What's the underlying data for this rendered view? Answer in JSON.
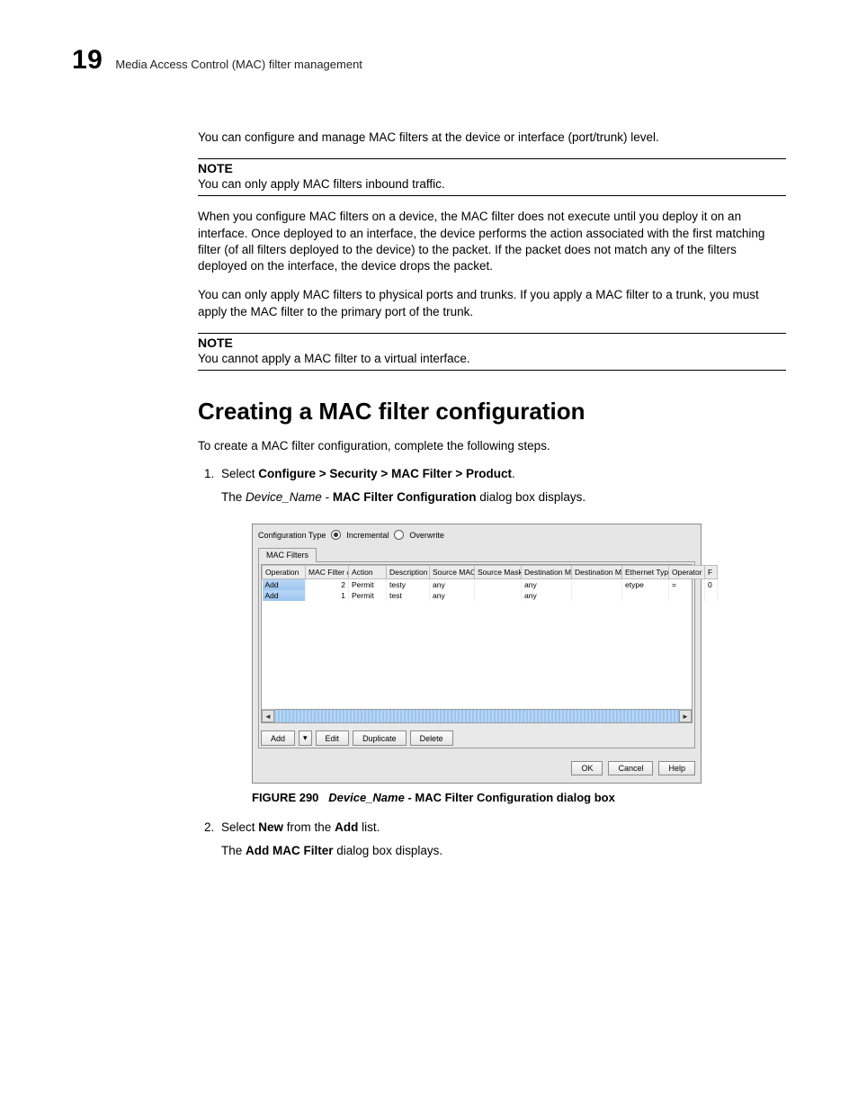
{
  "header": {
    "chapter_number": "19",
    "running_title": "Media Access Control (MAC) filter management"
  },
  "body": {
    "intro_para": "You can configure and manage MAC filters at the device or interface (port/trunk) level.",
    "note1_heading": "NOTE",
    "note1_text": "You can only apply MAC filters inbound traffic.",
    "para2": "When you configure MAC filters on a device, the MAC filter does not execute until you deploy it on an interface. Once deployed to an interface, the device performs the action associated with the first matching filter (of all filters deployed to the device) to the packet. If the packet does not match any of the filters deployed on the interface, the device drops the packet.",
    "para3": "You can only apply MAC filters to physical ports and trunks. If you apply a MAC filter to a trunk, you must apply the MAC filter to the primary port of the trunk.",
    "note2_heading": "NOTE",
    "note2_text": "You cannot apply a MAC filter to a virtual interface.",
    "section_title": "Creating a MAC filter configuration",
    "section_intro": "To create a MAC filter configuration, complete the following steps.",
    "step1_a": "Select ",
    "step1_b": "Configure > Security > MAC Filter > Product",
    "step1_c": ".",
    "step1_sub_a": "The ",
    "step1_sub_b": "Device_Name",
    "step1_sub_c": " - ",
    "step1_sub_d": "MAC Filter Configuration",
    "step1_sub_e": " dialog box displays.",
    "step2_a": "Select ",
    "step2_b": "New",
    "step2_c": " from the ",
    "step2_d": "Add",
    "step2_e": " list.",
    "step2_sub_a": "The ",
    "step2_sub_b": "Add MAC Filter",
    "step2_sub_c": " dialog box displays."
  },
  "dialog": {
    "cfg_type_label": "Configuration Type",
    "radio_incremental": "Incremental",
    "radio_overwrite": "Overwrite",
    "tab_label": "MAC Filters",
    "columns": [
      "Operation",
      "MAC Filter #",
      "Action",
      "Description",
      "Source MAC",
      "Source Mask",
      "Destination M...",
      "Destination M...",
      "Ethernet Type",
      "Operator",
      "F"
    ],
    "rows": [
      {
        "op": "Add",
        "num": "2",
        "action": "Permit",
        "desc": "testy",
        "src": "any",
        "smask": "",
        "dst": "any",
        "dmask": "",
        "etype": "etype",
        "operator": "=",
        "f": "0"
      },
      {
        "op": "Add",
        "num": "1",
        "action": "Permit",
        "desc": "test",
        "src": "any",
        "smask": "",
        "dst": "any",
        "dmask": "",
        "etype": "",
        "operator": "",
        "f": ""
      }
    ],
    "buttons": {
      "add": "Add",
      "dropdown": "▾",
      "edit": "Edit",
      "duplicate": "Duplicate",
      "delete": "Delete",
      "ok": "OK",
      "cancel": "Cancel",
      "help": "Help"
    }
  },
  "figure": {
    "lead": "FIGURE 290",
    "devname": "Device_Name",
    "rest": " - MAC Filter Configuration dialog box"
  }
}
